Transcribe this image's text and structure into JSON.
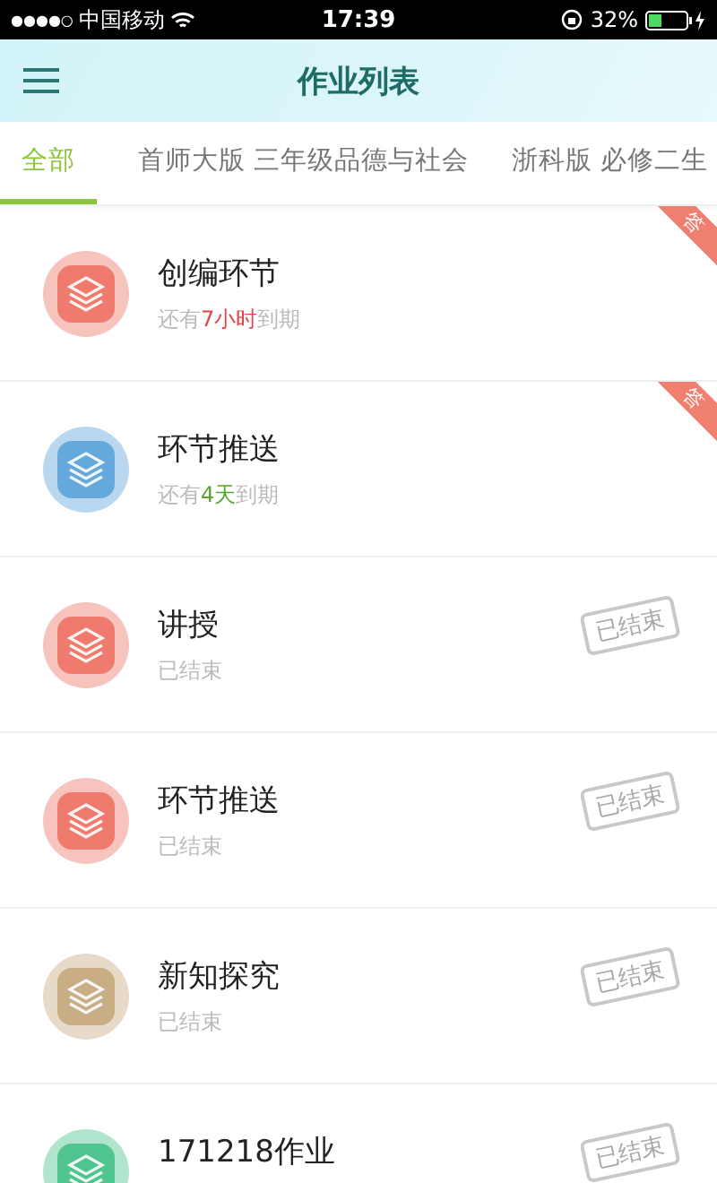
{
  "status_bar": {
    "signal": "●●●●○",
    "carrier": "中国移动",
    "time": "17:39",
    "battery": "32%"
  },
  "header": {
    "title": "作业列表"
  },
  "tabs": [
    {
      "label": "全部",
      "selected": true
    },
    {
      "label": "首师大版 三年级品德与社会",
      "selected": false
    },
    {
      "label": "浙科版 必修二生",
      "selected": false
    }
  ],
  "assignments": [
    {
      "title": "创编环节",
      "color": "#ee7b6d",
      "tag": "答",
      "status": {
        "before": "还有",
        "amount": "7小时",
        "after": "到期",
        "color": "#e0454b"
      }
    },
    {
      "title": "环节推送",
      "color": "#63a9dc",
      "tag": "答",
      "status": {
        "before": "还有",
        "amount": "4天",
        "after": "到期",
        "color": "#5aa52f"
      }
    },
    {
      "title": "讲授",
      "color": "#ee7b6d",
      "status": {
        "before": "已结束"
      },
      "stamp": "已结束"
    },
    {
      "title": "环节推送",
      "color": "#ee7b6d",
      "status": {
        "before": "已结束"
      },
      "stamp": "已结束"
    },
    {
      "title": "新知探究",
      "color": "#c9ad85",
      "status": {
        "before": "已结束"
      },
      "stamp": "已结束"
    },
    {
      "title": "171218作业",
      "color": "#4fc48f",
      "stamp": "已结束"
    }
  ]
}
